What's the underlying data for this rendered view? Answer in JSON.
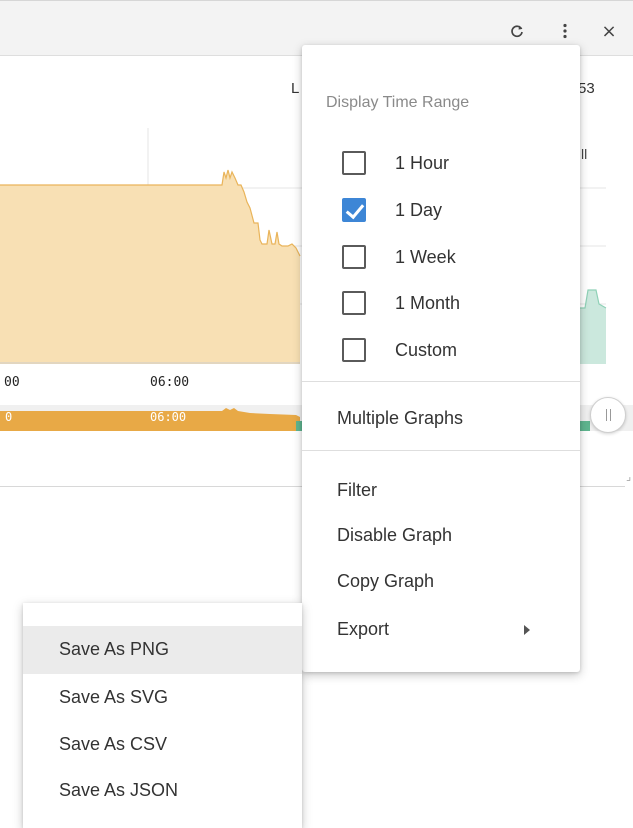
{
  "header": {
    "refresh_icon": "refresh-icon",
    "more_icon": "more-vertical-icon",
    "close_icon": "close-icon",
    "close_glyph": "×",
    "left_text": "L",
    "right_text": "53"
  },
  "graph": {
    "legend_text": "ll",
    "x_ticks": [
      "00",
      "06:00"
    ],
    "navigator_ticks": [
      "0",
      "06:00"
    ],
    "colors": {
      "area": "#f8e0b4",
      "area_line": "#e9b45a",
      "green_area": "#cbe8dd",
      "green_line": "#8fd1b7",
      "navigator": "#e8a946"
    }
  },
  "chart_data": {
    "type": "area",
    "title": "",
    "series": [
      {
        "values": []
      }
    ]
  },
  "menu": {
    "display_time_range": {
      "title": "Display Time Range",
      "options": [
        {
          "label": "1 Hour",
          "checked": false
        },
        {
          "label": "1 Day",
          "checked": true
        },
        {
          "label": "1 Week",
          "checked": false
        },
        {
          "label": "1 Month",
          "checked": false
        },
        {
          "label": "Custom",
          "checked": false
        }
      ]
    },
    "multiple_graphs": "Multiple Graphs",
    "filter": "Filter",
    "disable_graph": "Disable Graph",
    "copy_graph": "Copy Graph",
    "export": "Export"
  },
  "export_submenu": {
    "items": [
      "Save As PNG",
      "Save As SVG",
      "Save As CSV",
      "Save As JSON"
    ],
    "hovered_item": "Save As PNG"
  }
}
